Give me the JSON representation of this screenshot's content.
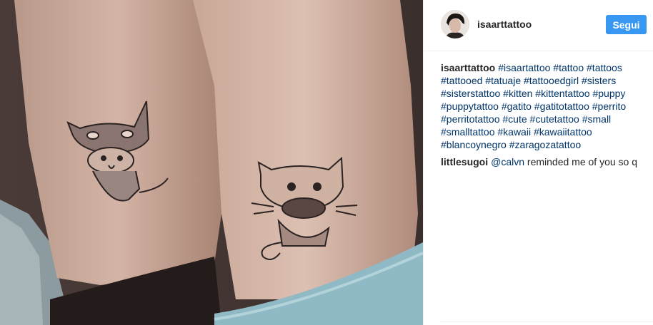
{
  "post": {
    "author": "isaarttattoo",
    "follow_label": "Segui"
  },
  "comments": [
    {
      "user": "isaarttattoo",
      "hashtags": [
        "#isaartattoo",
        "#tattoo",
        "#tattoos",
        "#tattooed",
        "#tatuaje",
        "#tattooedgirl",
        "#sisters",
        "#sisterstattoo",
        "#kitten",
        "#kittentattoo",
        "#puppy",
        "#puppytattoo",
        "#gatito",
        "#gatitotattoo",
        "#perrito",
        "#perritotattoo",
        "#cute",
        "#cutetattoo",
        "#small",
        "#smalltattoo",
        "#kawaii",
        "#kawaiitattoo",
        "#blancoynegro",
        "#zaragozatattoo"
      ]
    },
    {
      "user": "littlesugoi",
      "mention": "@calvn",
      "text": "reminded me of you so q"
    }
  ],
  "colors": {
    "follow_button": "#3897f0",
    "link": "#003569"
  }
}
